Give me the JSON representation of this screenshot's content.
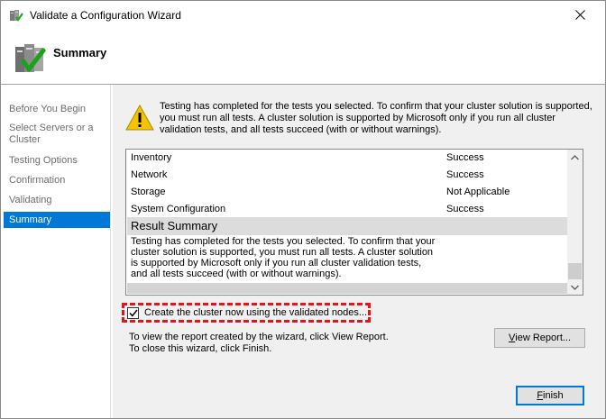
{
  "window": {
    "title": "Validate a Configuration Wizard"
  },
  "header": {
    "title": "Summary"
  },
  "sidebar": {
    "steps": [
      {
        "label": "Before You Begin"
      },
      {
        "label": "Select Servers or a Cluster"
      },
      {
        "label": "Testing Options"
      },
      {
        "label": "Confirmation"
      },
      {
        "label": "Validating"
      },
      {
        "label": "Summary"
      }
    ],
    "active": "Summary"
  },
  "intro_text": "Testing has completed for the tests you selected. To confirm that your cluster solution is supported, you must run all tests.  A cluster solution is supported by Microsoft only if you run all cluster validation tests, and all tests succeed (with or without warnings).",
  "report": {
    "rows": [
      {
        "name": "Inventory",
        "status": "Success"
      },
      {
        "name": "Network",
        "status": "Success"
      },
      {
        "name": "Storage",
        "status": "Not Applicable"
      },
      {
        "name": "System Configuration",
        "status": "Success"
      }
    ],
    "summary_heading": "Result Summary",
    "summary_text": "Testing has completed for the tests you selected. To confirm that your cluster solution is supported, you must run all tests.  A cluster solution is supported by Microsoft only if you run all cluster validation tests, and all tests succeed (with or without warnings)."
  },
  "create_cluster": {
    "label": "Create the cluster now using the validated nodes...",
    "checked": true
  },
  "info": {
    "line1": "To view the report created by the wizard, click View Report.",
    "line2": "To close this wizard, click Finish."
  },
  "buttons": {
    "view_report_u": "V",
    "view_report_rest": "iew Report...",
    "finish_u": "F",
    "finish_rest": "inish"
  },
  "colors": {
    "accent": "#0078d7",
    "highlight": "#e0161b",
    "warning": "#f5c400"
  }
}
